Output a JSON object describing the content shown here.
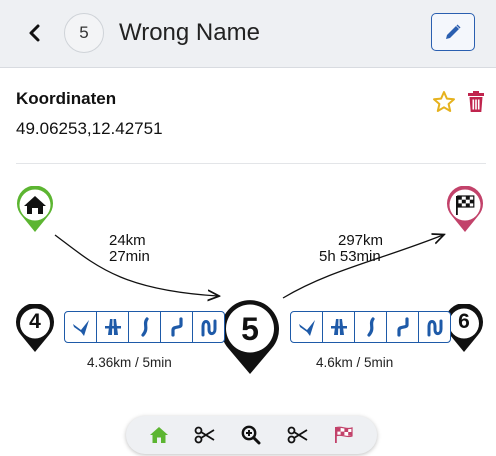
{
  "header": {
    "back_icon": "chevron-left-icon",
    "number": "5",
    "title": "Wrong Name",
    "edit_icon": "pencil-icon"
  },
  "details": {
    "label": "Koordinaten",
    "value": "49.06253,12.42751",
    "star_icon": "star-outline-icon",
    "trash_icon": "trash-icon"
  },
  "route": {
    "start_icon": "home-icon",
    "end_icon": "checkered-flag-icon",
    "prev_number": "4",
    "current_number": "5",
    "next_number": "6",
    "leg_in": {
      "distance": "24km",
      "duration": "27min"
    },
    "leg_out": {
      "distance": "297km",
      "duration": "5h 53min"
    },
    "segment_prev": "4.36km / 5min",
    "segment_next": "4.6km / 5min",
    "road_icons": [
      "exit-ramp-icon",
      "highway-icon",
      "curve-road-icon",
      "winding-road-icon",
      "switchback-road-icon"
    ]
  },
  "toolbar": {
    "items": [
      "home-icon",
      "scissors-icon",
      "zoom-in-icon",
      "scissors-icon",
      "checkered-flag-icon"
    ]
  },
  "colors": {
    "start_pin": "#5cb531",
    "end_pin": "#c2426a",
    "road_blue": "#1e5aa8",
    "star": "#e6b21e",
    "trash": "#c0244d",
    "edit_blue": "#2a5fb0"
  }
}
